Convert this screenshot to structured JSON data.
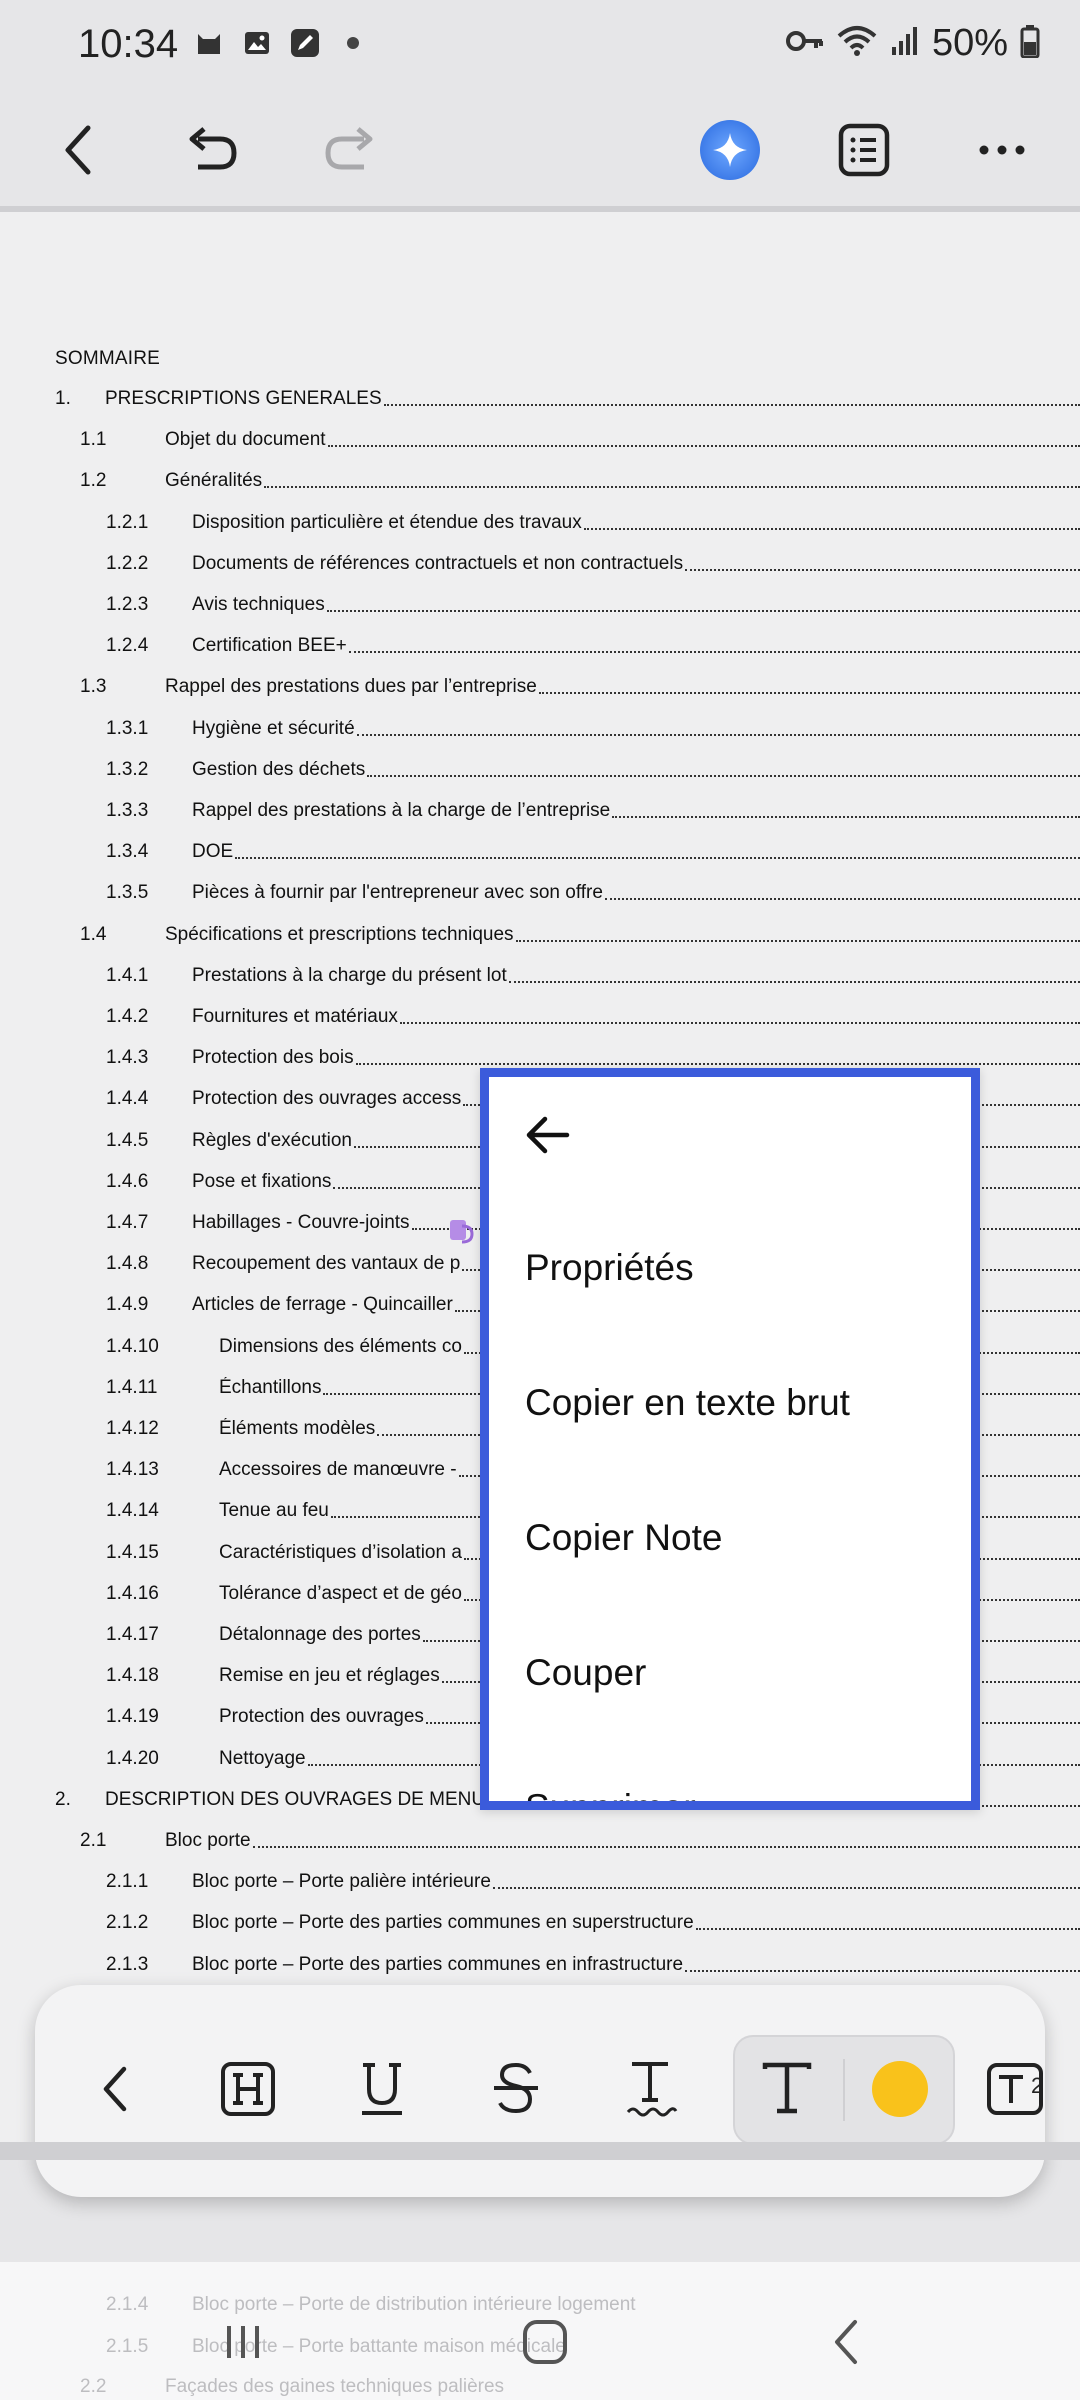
{
  "status_bar": {
    "time": "10:34",
    "battery": "50%",
    "left_icons": [
      "cat-icon",
      "image-icon",
      "pen-note-icon",
      "dot-icon"
    ],
    "right_icons": [
      "key-icon",
      "wifi-icon",
      "signal-icon",
      "battery-icon"
    ]
  },
  "toolbar": {
    "buttons": [
      "back-icon",
      "undo-icon",
      "redo-icon",
      "ai-assist-icon",
      "list-icon",
      "more-icon"
    ]
  },
  "document": {
    "heading": "SOMMAIRE",
    "toc": [
      {
        "num": "1.",
        "text": "PRESCRIPTIONS GENERALES",
        "level": 0
      },
      {
        "num": "1.1",
        "text": "Objet du document",
        "level": 1
      },
      {
        "num": "1.2",
        "text": "Généralités",
        "level": 1
      },
      {
        "num": "1.2.1",
        "text": "Disposition particulière et étendue des travaux",
        "level": 2
      },
      {
        "num": "1.2.2",
        "text": "Documents de références contractuels et non contractuels",
        "level": 2
      },
      {
        "num": "1.2.3",
        "text": "Avis techniques",
        "level": 2
      },
      {
        "num": "1.2.4",
        "text": "Certification BEE+",
        "level": 2
      },
      {
        "num": "1.3",
        "text": "Rappel des prestations dues par l’entreprise",
        "level": 1
      },
      {
        "num": "1.3.1",
        "text": "Hygiène et sécurité",
        "level": 2
      },
      {
        "num": "1.3.2",
        "text": "Gestion des déchets",
        "level": 2
      },
      {
        "num": "1.3.3",
        "text": "Rappel des prestations à la charge de l’entreprise",
        "level": 2
      },
      {
        "num": "1.3.4",
        "text": "DOE",
        "level": 2
      },
      {
        "num": "1.3.5",
        "text": "Pièces à fournir par l'entrepreneur avec son offre",
        "level": 2
      },
      {
        "num": "1.4",
        "text": "Spécifications et prescriptions techniques",
        "level": 1
      },
      {
        "num": "1.4.1",
        "text": "Prestations à la charge du présent lot",
        "level": 2
      },
      {
        "num": "1.4.2",
        "text": "Fournitures et matériaux",
        "level": 2
      },
      {
        "num": "1.4.3",
        "text": "Protection des bois",
        "level": 2
      },
      {
        "num": "1.4.4",
        "text": "Protection des ouvrages access",
        "level": 2
      },
      {
        "num": "1.4.5",
        "text": "Règles d'exécution",
        "level": 2
      },
      {
        "num": "1.4.6",
        "text": "Pose et fixations",
        "level": 2
      },
      {
        "num": "1.4.7",
        "text": "Habillages - Couvre-joints",
        "level": 2
      },
      {
        "num": "1.4.8",
        "text": "Recoupement des vantaux de p",
        "level": 2
      },
      {
        "num": "1.4.9",
        "text": "Articles de ferrage - Quincailler",
        "level": 2
      },
      {
        "num": "1.4.10",
        "text": "Dimensions des éléments co",
        "level": 3
      },
      {
        "num": "1.4.11",
        "text": "Échantillons",
        "level": 3
      },
      {
        "num": "1.4.12",
        "text": "Éléments modèles",
        "level": 3
      },
      {
        "num": "1.4.13",
        "text": "Accessoires de manœuvre -",
        "level": 3
      },
      {
        "num": "1.4.14",
        "text": "Tenue au feu",
        "level": 3
      },
      {
        "num": "1.4.15",
        "text": "Caractéristiques d’isolation a",
        "level": 3
      },
      {
        "num": "1.4.16",
        "text": "Tolérance d’aspect et de géo",
        "level": 3
      },
      {
        "num": "1.4.17",
        "text": "Détalonnage des portes",
        "level": 3
      },
      {
        "num": "1.4.18",
        "text": "Remise en jeu et réglages",
        "level": 3
      },
      {
        "num": "1.4.19",
        "text": "Protection des ouvrages",
        "level": 3
      },
      {
        "num": "1.4.20",
        "text": "Nettoyage",
        "level": 3
      },
      {
        "num": "2.",
        "text": "DESCRIPTION DES OUVRAGES DE MENUISERIES",
        "level": 0
      },
      {
        "num": "2.1",
        "text": "Bloc porte",
        "level": 1
      },
      {
        "num": "2.1.1",
        "text": "Bloc porte – Porte palière intérieure",
        "level": 2
      },
      {
        "num": "2.1.2",
        "text": "Bloc porte – Porte des parties communes en superstructure",
        "level": 2
      },
      {
        "num": "2.1.3",
        "text": "Bloc porte – Porte des parties communes en infrastructure",
        "level": 2
      }
    ],
    "faded_toc": [
      {
        "num": "2.1.4",
        "text": "Bloc porte – Porte de distribution intérieure logement"
      },
      {
        "num": "2.1.5",
        "text": "Bloc porte – Porte battante maison médicale"
      },
      {
        "num": "2.2",
        "text": "Façades des gaines techniques palières"
      }
    ]
  },
  "context_menu": {
    "items": [
      "Propriétés",
      "Copier en texte brut",
      "Copier Note",
      "Couper",
      "Supprimer"
    ]
  },
  "format_toolbar": {
    "buttons": [
      "back-icon",
      "highlight-h-icon",
      "underline-icon",
      "strikethrough-icon",
      "wavy-underline-text-icon",
      "text-style-icon",
      "color-swatch",
      "text-box-icon"
    ],
    "color": "#f9c21b",
    "page_indicator": "2"
  },
  "nav_bar": {
    "buttons": [
      "recent-apps-icon",
      "home-icon",
      "back-icon"
    ]
  },
  "colors": {
    "accent": "#3b5bdb",
    "highlight": "#f9c21b",
    "ai_button": "#3d7be8"
  }
}
